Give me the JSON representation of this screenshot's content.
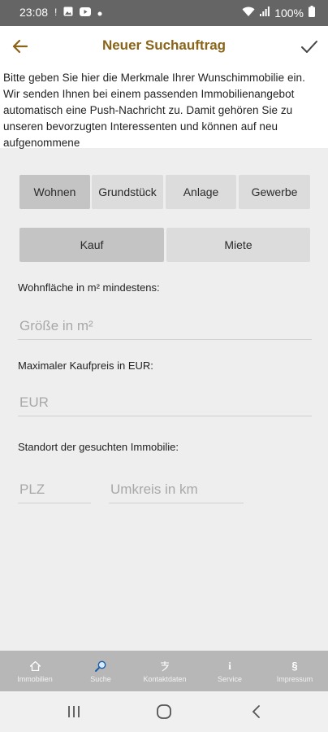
{
  "status_bar": {
    "time": "23:08",
    "battery": "100%",
    "icons_left": [
      "alert-icon",
      "image-icon",
      "youtube-icon",
      "dot-icon"
    ],
    "icons_right": [
      "wifi-icon",
      "signal-icon",
      "battery-icon"
    ]
  },
  "header": {
    "title": "Neuer Suchauftrag",
    "back_icon": "arrow-left-icon",
    "confirm_icon": "check-icon"
  },
  "intro_text": "Bitte geben Sie hier die Merkmale Ihrer Wunschimmobilie ein. Wir senden Ihnen bei einem passenden Immobilienangebot automatisch eine Push-Nachricht zu. Damit gehören Sie zu unseren bevorzugten Interessenten und können auf neu aufgenommene",
  "category_tabs": [
    {
      "label": "Wohnen",
      "active": true
    },
    {
      "label": "Grundstück",
      "active": false
    },
    {
      "label": "Anlage",
      "active": false
    },
    {
      "label": "Gewerbe",
      "active": false
    }
  ],
  "deal_tabs": [
    {
      "label": "Kauf",
      "active": true
    },
    {
      "label": "Miete",
      "active": false
    }
  ],
  "form": {
    "area_label": "Wohnfläche in m² mindestens:",
    "area_placeholder": "Größe in m²",
    "area_value": "",
    "price_label": "Maximaler Kaufpreis in EUR:",
    "price_placeholder": "EUR",
    "price_value": "",
    "location_label": "Standort der gesuchten Immobilie:",
    "zip_placeholder": "PLZ",
    "zip_value": "",
    "radius_placeholder": "Umkreis in km",
    "radius_value": ""
  },
  "bottom_nav": [
    {
      "label": "Immobilien",
      "icon": "home-icon"
    },
    {
      "label": "Suche",
      "icon": "search-icon"
    },
    {
      "label": "Kontaktdaten",
      "icon": "contact-icon"
    },
    {
      "label": "Service",
      "icon": "info-icon"
    },
    {
      "label": "Impressum",
      "icon": "section-icon"
    }
  ],
  "colors": {
    "accent": "#8a6418",
    "status_bar": "#656565",
    "bottom_nav": "#b7b7b7",
    "background": "#eeeeee"
  }
}
